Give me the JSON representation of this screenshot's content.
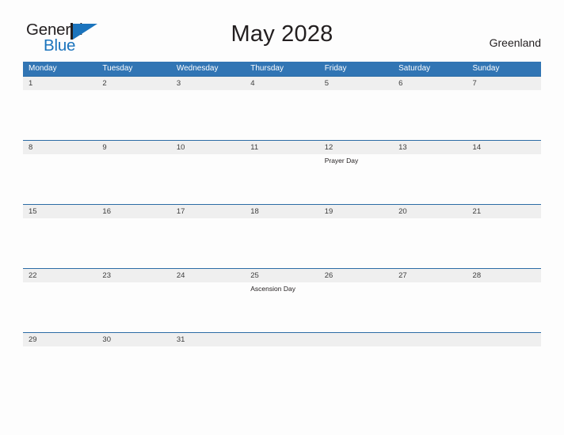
{
  "brand": {
    "name_part1": "General",
    "name_part2": "Blue",
    "accent_color": "#1b74bd"
  },
  "header": {
    "title": "May 2028",
    "country": "Greenland"
  },
  "theme": {
    "header_bg": "#3175b4",
    "row_divider": "#2c6ca5",
    "date_band": "#efefef",
    "page_bg": "#fdfdfd"
  },
  "calendar": {
    "weekday_headers": [
      "Monday",
      "Tuesday",
      "Wednesday",
      "Thursday",
      "Friday",
      "Saturday",
      "Sunday"
    ],
    "weeks": [
      {
        "days": [
          {
            "num": "1",
            "event": ""
          },
          {
            "num": "2",
            "event": ""
          },
          {
            "num": "3",
            "event": ""
          },
          {
            "num": "4",
            "event": ""
          },
          {
            "num": "5",
            "event": ""
          },
          {
            "num": "6",
            "event": ""
          },
          {
            "num": "7",
            "event": ""
          }
        ]
      },
      {
        "days": [
          {
            "num": "8",
            "event": ""
          },
          {
            "num": "9",
            "event": ""
          },
          {
            "num": "10",
            "event": ""
          },
          {
            "num": "11",
            "event": ""
          },
          {
            "num": "12",
            "event": "Prayer Day"
          },
          {
            "num": "13",
            "event": ""
          },
          {
            "num": "14",
            "event": ""
          }
        ]
      },
      {
        "days": [
          {
            "num": "15",
            "event": ""
          },
          {
            "num": "16",
            "event": ""
          },
          {
            "num": "17",
            "event": ""
          },
          {
            "num": "18",
            "event": ""
          },
          {
            "num": "19",
            "event": ""
          },
          {
            "num": "20",
            "event": ""
          },
          {
            "num": "21",
            "event": ""
          }
        ]
      },
      {
        "days": [
          {
            "num": "22",
            "event": ""
          },
          {
            "num": "23",
            "event": ""
          },
          {
            "num": "24",
            "event": ""
          },
          {
            "num": "25",
            "event": "Ascension Day"
          },
          {
            "num": "26",
            "event": ""
          },
          {
            "num": "27",
            "event": ""
          },
          {
            "num": "28",
            "event": ""
          }
        ]
      },
      {
        "last": true,
        "days": [
          {
            "num": "29",
            "event": ""
          },
          {
            "num": "30",
            "event": ""
          },
          {
            "num": "31",
            "event": ""
          },
          {
            "num": "",
            "event": ""
          },
          {
            "num": "",
            "event": ""
          },
          {
            "num": "",
            "event": ""
          },
          {
            "num": "",
            "event": ""
          }
        ]
      }
    ]
  }
}
